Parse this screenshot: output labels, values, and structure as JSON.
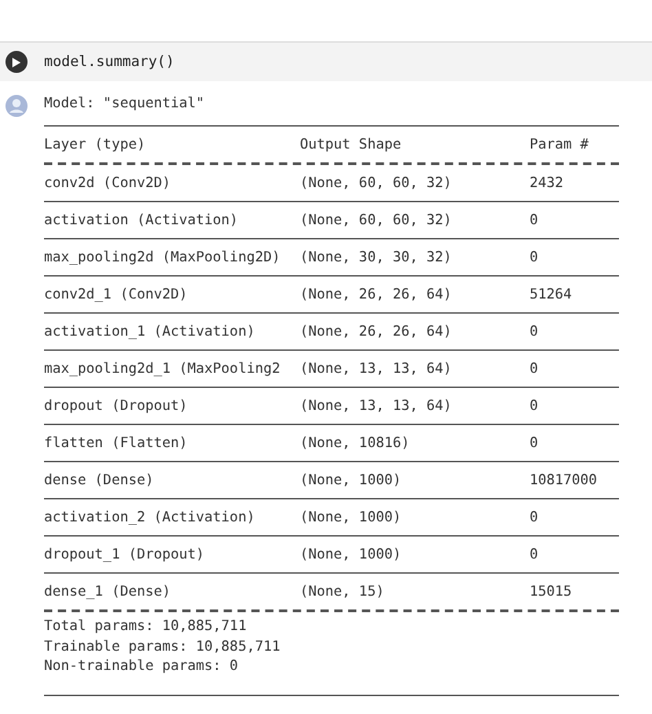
{
  "cell": {
    "code": "model.summary()"
  },
  "output": {
    "model_line": "Model: \"sequential\"",
    "columns": [
      "Layer (type)",
      "Output Shape",
      "Param #"
    ],
    "rows": [
      {
        "layer": "conv2d (Conv2D)",
        "shape": "(None, 60, 60, 32)",
        "params": "2432"
      },
      {
        "layer": "activation (Activation)",
        "shape": "(None, 60, 60, 32)",
        "params": "0"
      },
      {
        "layer": "max_pooling2d (MaxPooling2D)",
        "shape": "(None, 30, 30, 32)",
        "params": "0"
      },
      {
        "layer": "conv2d_1 (Conv2D)",
        "shape": "(None, 26, 26, 64)",
        "params": "51264"
      },
      {
        "layer": "activation_1 (Activation)",
        "shape": "(None, 26, 26, 64)",
        "params": "0"
      },
      {
        "layer": "max_pooling2d_1 (MaxPooling2",
        "shape": "(None, 13, 13, 64)",
        "params": "0"
      },
      {
        "layer": "dropout (Dropout)",
        "shape": "(None, 13, 13, 64)",
        "params": "0"
      },
      {
        "layer": "flatten (Flatten)",
        "shape": "(None, 10816)",
        "params": "0"
      },
      {
        "layer": "dense (Dense)",
        "shape": "(None, 1000)",
        "params": "10817000"
      },
      {
        "layer": "activation_2 (Activation)",
        "shape": "(None, 1000)",
        "params": "0"
      },
      {
        "layer": "dropout_1 (Dropout)",
        "shape": "(None, 1000)",
        "params": "0"
      },
      {
        "layer": "dense_1 (Dense)",
        "shape": "(None, 15)",
        "params": "15015"
      }
    ],
    "totals": [
      "Total params: 10,885,711",
      "Trainable params: 10,885,711",
      "Non-trainable params: 0"
    ]
  }
}
